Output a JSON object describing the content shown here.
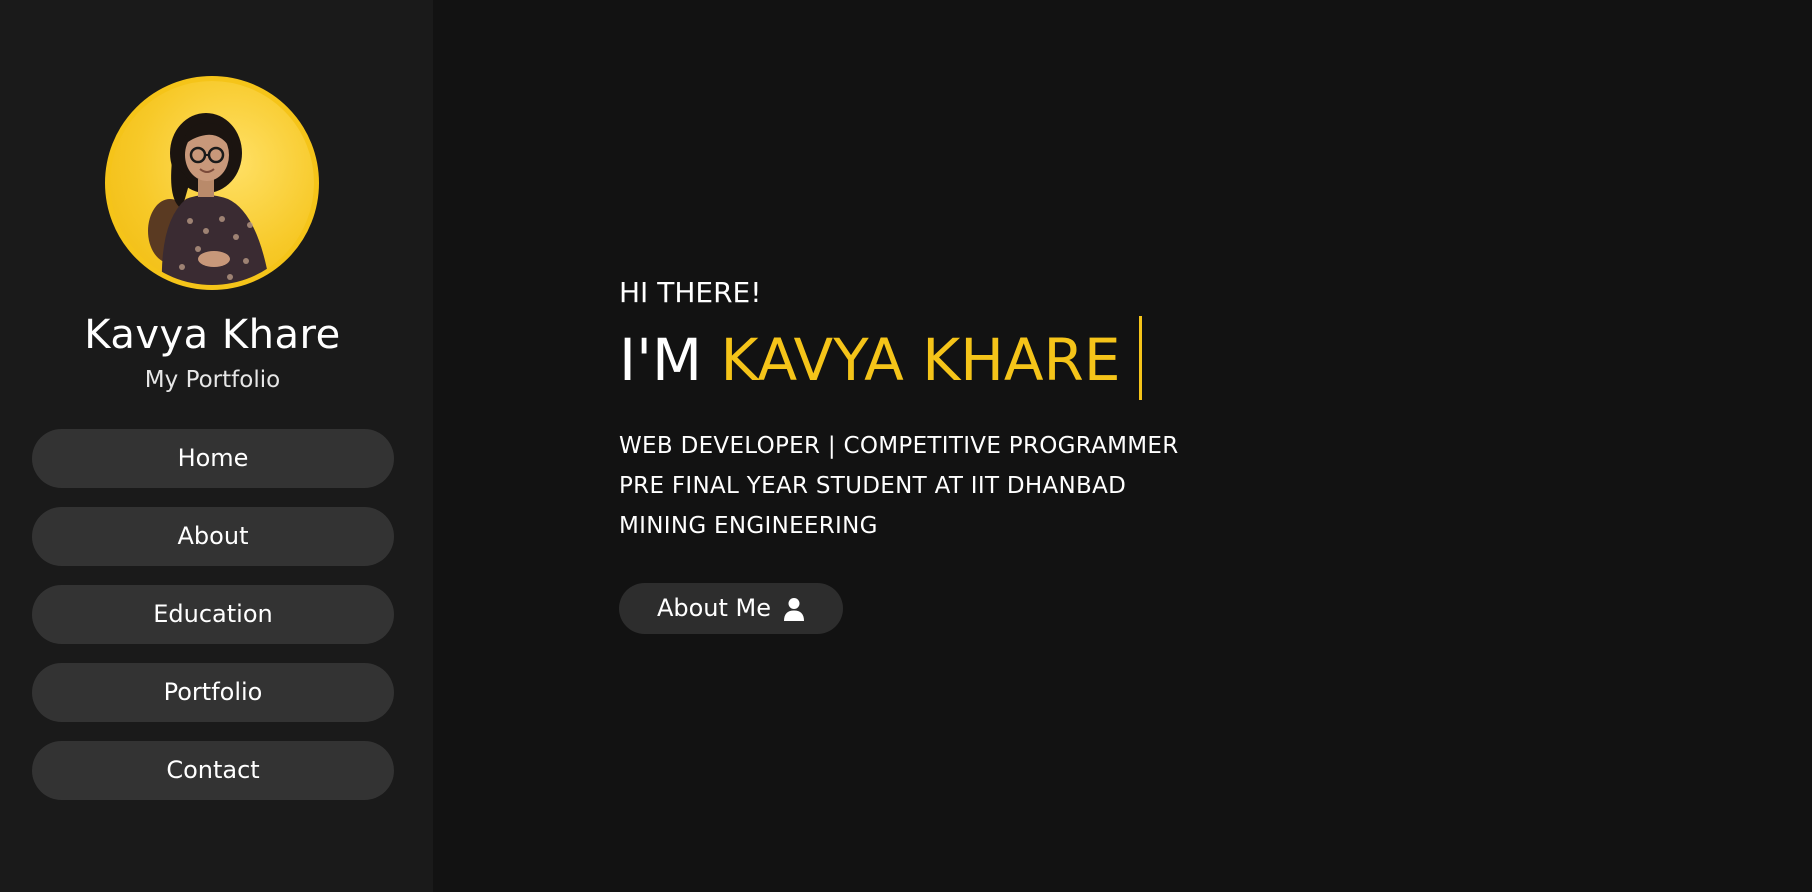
{
  "sidebar": {
    "profile": {
      "name": "Kavya Khare",
      "tagline": "My Portfolio",
      "avatar_icon": "profile-photo"
    },
    "nav": [
      {
        "label": "Home"
      },
      {
        "label": "About"
      },
      {
        "label": "Education"
      },
      {
        "label": "Portfolio"
      },
      {
        "label": "Contact"
      }
    ]
  },
  "hero": {
    "greeting": "HI THERE!",
    "headline_prefix": "I'M ",
    "headline_name": "KAVYA KHARE",
    "roles": [
      "WEB DEVELOPER | COMPETITIVE PROGRAMMER",
      "PRE FINAL YEAR STUDENT AT IIT DHANBAD",
      "MINING ENGINEERING"
    ],
    "cta_label": "About Me",
    "cta_icon": "user-icon"
  },
  "colors": {
    "accent": "#f5c419",
    "background": "#121212",
    "sidebar": "#1a1a1a",
    "button": "#333333"
  }
}
